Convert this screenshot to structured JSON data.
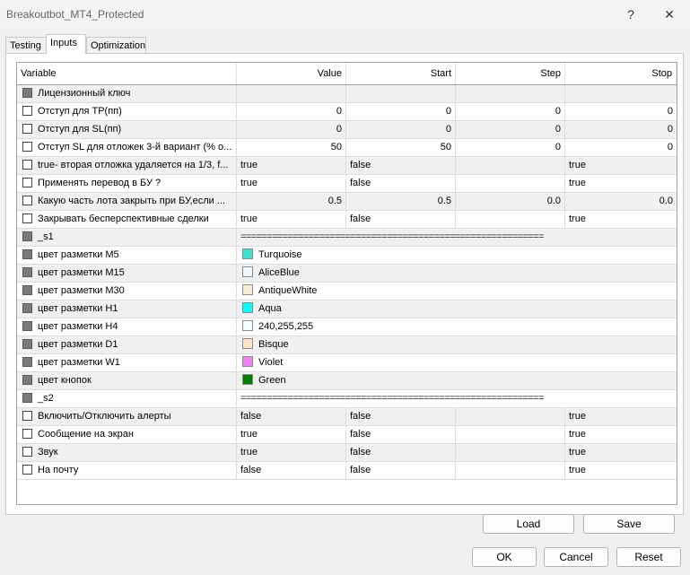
{
  "window": {
    "title": "Breakoutbot_MT4_Protected",
    "help_glyph": "?",
    "close_glyph": "✕"
  },
  "tabs": [
    {
      "label": "Testing"
    },
    {
      "label": "Inputs",
      "active": true
    },
    {
      "label": "Optimization"
    }
  ],
  "table": {
    "headers": {
      "variable": "Variable",
      "value": "Value",
      "start": "Start",
      "step": "Step",
      "stop": "Stop"
    },
    "rows": [
      {
        "variable": "Лицензионный ключ",
        "checkbox": "gray",
        "kind": "text",
        "value": "",
        "start": "",
        "step": "",
        "stop": ""
      },
      {
        "variable": "Отступ  для TP(пп)",
        "checkbox": "unchecked",
        "kind": "numeric",
        "value": "0",
        "start": "0",
        "step": "0",
        "stop": "0"
      },
      {
        "variable": "Отступ для SL(пп)",
        "checkbox": "unchecked",
        "kind": "numeric",
        "value": "0",
        "start": "0",
        "step": "0",
        "stop": "0"
      },
      {
        "variable": "Отступ SL для отложек 3-й вариант (% о...",
        "checkbox": "unchecked",
        "kind": "numeric",
        "value": "50",
        "start": "50",
        "step": "0",
        "stop": "0"
      },
      {
        "variable": "true- вторая отложка удаляется на 1/3, f...",
        "checkbox": "unchecked",
        "kind": "bool",
        "value": "true",
        "start": "false",
        "step": "",
        "stop": "true"
      },
      {
        "variable": "Применять перевод в БУ ?",
        "checkbox": "unchecked",
        "kind": "bool",
        "value": "true",
        "start": "false",
        "step": "",
        "stop": "true"
      },
      {
        "variable": "Какую часть лота закрыть при БУ,если ...",
        "checkbox": "unchecked",
        "kind": "numeric",
        "value": "0.5",
        "start": "0.5",
        "step": "0.0",
        "stop": "0.0"
      },
      {
        "variable": "Закрывать бесперспективные сделки",
        "checkbox": "unchecked",
        "kind": "bool",
        "value": "true",
        "start": "false",
        "step": "",
        "stop": "true"
      },
      {
        "variable": "_s1",
        "checkbox": "gray",
        "kind": "separator",
        "value": "=========================================================="
      },
      {
        "variable": "цвет разметки M5",
        "checkbox": "gray",
        "kind": "color",
        "value": "Turquoise",
        "swatch": "#40e0d0"
      },
      {
        "variable": "цвет разметки M15",
        "checkbox": "gray",
        "kind": "color",
        "value": "AliceBlue",
        "swatch": "#f0f8ff"
      },
      {
        "variable": "цвет разметки M30",
        "checkbox": "gray",
        "kind": "color",
        "value": "AntiqueWhite",
        "swatch": "#faebd7"
      },
      {
        "variable": "цвет разметки H1",
        "checkbox": "gray",
        "kind": "color",
        "value": "Aqua",
        "swatch": "#00ffff"
      },
      {
        "variable": "цвет разметки H4",
        "checkbox": "gray",
        "kind": "color",
        "value": "240,255,255",
        "swatch": "#f0ffff"
      },
      {
        "variable": "цвет разметки D1",
        "checkbox": "gray",
        "kind": "color",
        "value": "Bisque",
        "swatch": "#ffe4c4"
      },
      {
        "variable": "цвет разметки W1",
        "checkbox": "gray",
        "kind": "color",
        "value": "Violet",
        "swatch": "#ee82ee"
      },
      {
        "variable": "цвет  кнопок",
        "checkbox": "gray",
        "kind": "color",
        "value": "Green",
        "swatch": "#008000"
      },
      {
        "variable": "_s2",
        "checkbox": "gray",
        "kind": "separator",
        "value": "=========================================================="
      },
      {
        "variable": "Включить/Отключить алерты",
        "checkbox": "unchecked",
        "kind": "bool",
        "value": "false",
        "start": "false",
        "step": "",
        "stop": "true"
      },
      {
        "variable": "Сообщение на экран",
        "checkbox": "unchecked",
        "kind": "bool",
        "value": "true",
        "start": "false",
        "step": "",
        "stop": "true"
      },
      {
        "variable": "Звук",
        "checkbox": "unchecked",
        "kind": "bool",
        "value": "true",
        "start": "false",
        "step": "",
        "stop": "true"
      },
      {
        "variable": "На почту",
        "checkbox": "unchecked",
        "kind": "bool",
        "value": "false",
        "start": "false",
        "step": "",
        "stop": "true"
      }
    ]
  },
  "buttons": {
    "load": "Load",
    "save": "Save",
    "ok": "OK",
    "cancel": "Cancel",
    "reset": "Reset"
  }
}
